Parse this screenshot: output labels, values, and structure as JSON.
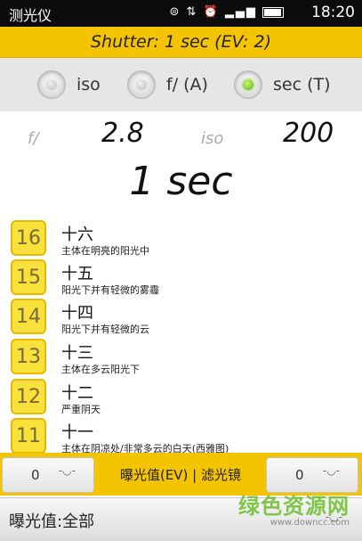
{
  "status_bar": {
    "app_title": "测光仪",
    "icons": [
      "usb-icon",
      "sync-icon",
      "alarm-icon",
      "signal-icon",
      "battery-icon"
    ],
    "time": "18:20"
  },
  "shutter_banner": {
    "text": "Shutter: 1 sec (EV: 2)"
  },
  "mode_radios": [
    {
      "label": "iso",
      "selected": false
    },
    {
      "label": "f/ (A)",
      "selected": false
    },
    {
      "label": "sec (T)",
      "selected": true
    }
  ],
  "readout": {
    "f_label": "f/",
    "f_value": "2.8",
    "iso_label": "iso",
    "iso_value": "200",
    "shutter_value": "1 sec"
  },
  "ev_list": [
    {
      "ev": "16",
      "title": "十六",
      "desc": "主体在明亮的阳光中"
    },
    {
      "ev": "15",
      "title": "十五",
      "desc": "阳光下并有轻微的雾霾"
    },
    {
      "ev": "14",
      "title": "十四",
      "desc": "阳光下并有轻微的云"
    },
    {
      "ev": "13",
      "title": "十三",
      "desc": "主体在多云阳光下"
    },
    {
      "ev": "12",
      "title": "十二",
      "desc": "严重阴天"
    },
    {
      "ev": "11",
      "title": "十一",
      "desc": "主体在阴凉处/非常多云的白天(西雅图)"
    }
  ],
  "controls": {
    "left_spinner_value": "0",
    "right_spinner_value": "0",
    "label": "曝光值(EV) | 滤光镜"
  },
  "exposure_select": {
    "value": "曝光值:全部"
  },
  "watermark": {
    "main": "绿色资源网",
    "sub": "www.downcc.com"
  },
  "colors": {
    "accent_yellow": "#f5c400",
    "badge_yellow": "#f8e13a",
    "radio_selected": "#5fb41b"
  }
}
